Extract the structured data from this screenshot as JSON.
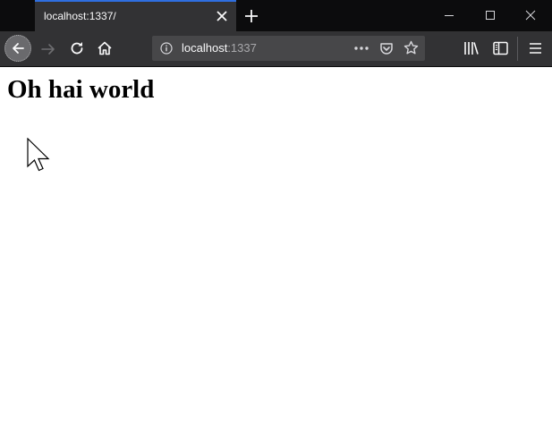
{
  "browser": {
    "tab": {
      "title": "localhost:1337/"
    },
    "urlbar": {
      "host": "localhost",
      "port": ":1337"
    },
    "icons": {
      "back": "arrow-left-icon",
      "forward": "arrow-right-icon",
      "reload": "reload-icon",
      "home": "home-icon",
      "site_info": "info-icon",
      "page_actions": "more-horizontal-icon",
      "pocket": "pocket-icon",
      "bookmark": "star-icon",
      "library": "library-icon",
      "sidebar": "sidebar-icon",
      "menu": "hamburger-icon",
      "new_tab": "plus-icon",
      "tab_close": "close-icon",
      "minimize": "minimize-icon",
      "maximize": "maximize-icon",
      "close": "close-icon"
    },
    "colors": {
      "tabstrip": "#0c0c0d",
      "toolbar": "#323234",
      "urlbar": "#474749",
      "active_tab_accent": "#2f6fe0"
    }
  },
  "page": {
    "heading": "Oh hai world"
  }
}
